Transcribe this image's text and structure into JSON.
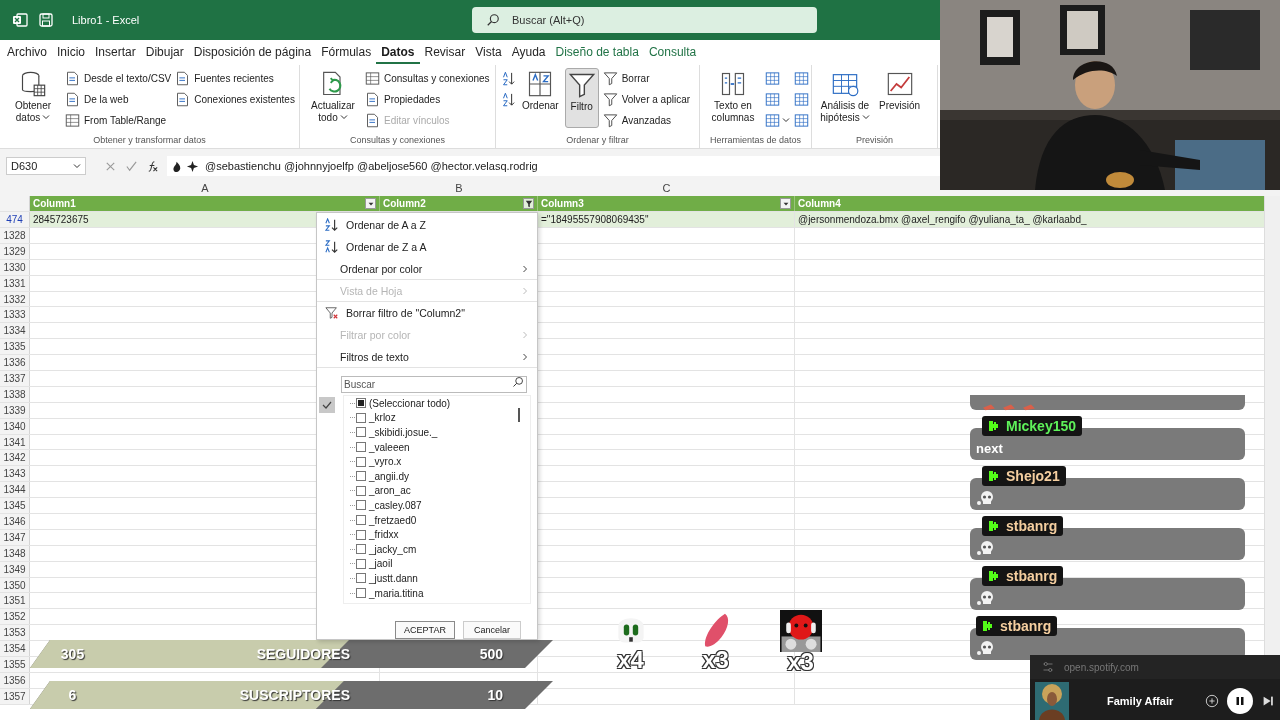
{
  "window": {
    "title": "Libro1  -  Excel"
  },
  "search": {
    "placeholder": "Buscar (Alt+Q)"
  },
  "menu_tabs": [
    {
      "label": "Archivo",
      "selected": false,
      "kind": "normal"
    },
    {
      "label": "Inicio",
      "selected": false,
      "kind": "normal"
    },
    {
      "label": "Insertar",
      "selected": false,
      "kind": "normal"
    },
    {
      "label": "Dibujar",
      "selected": false,
      "kind": "normal"
    },
    {
      "label": "Disposición de página",
      "selected": false,
      "kind": "normal"
    },
    {
      "label": "Fórmulas",
      "selected": false,
      "kind": "normal"
    },
    {
      "label": "Datos",
      "selected": true,
      "kind": "normal"
    },
    {
      "label": "Revisar",
      "selected": false,
      "kind": "normal"
    },
    {
      "label": "Vista",
      "selected": false,
      "kind": "normal"
    },
    {
      "label": "Ayuda",
      "selected": false,
      "kind": "normal"
    },
    {
      "label": "Diseño de tabla",
      "selected": false,
      "kind": "contextual"
    },
    {
      "label": "Consulta",
      "selected": false,
      "kind": "contextual"
    }
  ],
  "ribbon": {
    "groups": [
      {
        "label": "Obtener y transformar datos",
        "columns": [
          [
            {
              "kind": "large",
              "label": "Obtener datos",
              "dropdown": true
            }
          ],
          [
            {
              "kind": "small",
              "label": "Desde el texto/CSV"
            },
            {
              "kind": "small",
              "label": "De la web"
            },
            {
              "kind": "small",
              "label": "From Table/Range"
            }
          ],
          [
            {
              "kind": "small",
              "label": "Fuentes recientes"
            },
            {
              "kind": "small",
              "label": "Conexiones existentes"
            }
          ]
        ]
      },
      {
        "label": "Consultas y conexiones",
        "columns": [
          [
            {
              "kind": "large",
              "label": "Actualizar todo",
              "dropdown": true
            }
          ],
          [
            {
              "kind": "small",
              "label": "Consultas y conexiones"
            },
            {
              "kind": "small",
              "label": "Propiedades"
            },
            {
              "kind": "small",
              "label": "Editar vínculos",
              "disabled": true
            }
          ]
        ]
      },
      {
        "label": "Ordenar y filtrar",
        "columns": [
          [
            {
              "kind": "icon"
            },
            {
              "kind": "icon"
            }
          ],
          [
            {
              "kind": "large",
              "label": "Ordenar"
            }
          ],
          [
            {
              "kind": "large",
              "label": "Filtro",
              "selected": true
            }
          ],
          [
            {
              "kind": "small",
              "label": "Borrar"
            },
            {
              "kind": "small",
              "label": "Volver a aplicar"
            },
            {
              "kind": "small",
              "label": "Avanzadas"
            }
          ]
        ]
      },
      {
        "label": "Herramientas de datos",
        "columns": [
          [
            {
              "kind": "large",
              "label": "Texto en columnas"
            }
          ],
          [
            {
              "kind": "icon"
            },
            {
              "kind": "icon"
            },
            {
              "kind": "icon",
              "dropdown": true
            }
          ],
          [
            {
              "kind": "icon"
            },
            {
              "kind": "icon"
            },
            {
              "kind": "icon"
            }
          ]
        ]
      },
      {
        "label": "Previsión",
        "columns": [
          [
            {
              "kind": "large",
              "label": "Análisis de hipótesis",
              "dropdown": true
            }
          ],
          [
            {
              "kind": "large",
              "label": "Previsión"
            }
          ]
        ]
      }
    ]
  },
  "formula_bar": {
    "name_box": "D630",
    "formula": "@sebastienchu  @johnnyjoelfp  @abeljose560  @hector.velasq.rodrig"
  },
  "sheet": {
    "column_letters": [
      "A",
      "B",
      "C"
    ],
    "table_headers": [
      {
        "label": "Column1",
        "filter_active": false
      },
      {
        "label": "Column2",
        "filter_active": true
      },
      {
        "label": "Column3",
        "filter_active": false
      },
      {
        "label": "Column4"
      }
    ],
    "active_row": {
      "number": "474",
      "cells": [
        "2845723675",
        "",
        "=\"18495557908069435\"",
        "@jersonmendoza.bmx @axel_rengifo @yuliana_ta_ @karlaabd_"
      ]
    },
    "rows": [
      {
        "number": "1328"
      },
      {
        "number": "1329"
      },
      {
        "number": "1330"
      },
      {
        "number": "1331"
      },
      {
        "number": "1332"
      },
      {
        "number": "1333"
      },
      {
        "number": "1334"
      },
      {
        "number": "1335"
      },
      {
        "number": "1336"
      },
      {
        "number": "1337"
      },
      {
        "number": "1338"
      },
      {
        "number": "1339"
      },
      {
        "number": "1340"
      },
      {
        "number": "1341"
      },
      {
        "number": "1342"
      },
      {
        "number": "1343"
      },
      {
        "number": "1344"
      },
      {
        "number": "1345"
      },
      {
        "number": "1346"
      },
      {
        "number": "1347"
      },
      {
        "number": "1348"
      },
      {
        "number": "1349"
      },
      {
        "number": "1350"
      },
      {
        "number": "1351"
      },
      {
        "number": "1352"
      },
      {
        "number": "1353"
      },
      {
        "number": "1354"
      },
      {
        "number": "1355"
      },
      {
        "number": "1356"
      },
      {
        "number": "1357"
      }
    ]
  },
  "filter_menu": {
    "items": [
      {
        "label": "Ordenar de A a Z",
        "kind": "sort-az",
        "disabled": false,
        "submenu": false,
        "separator": false
      },
      {
        "label": "Ordenar de Z a A",
        "kind": "sort-za",
        "disabled": false,
        "submenu": false,
        "separator": false
      },
      {
        "label": "Ordenar por color",
        "kind": "plain",
        "disabled": false,
        "submenu": true,
        "separator": true
      },
      {
        "label": "Vista de Hoja",
        "kind": "plain",
        "disabled": true,
        "submenu": true,
        "separator": true
      },
      {
        "label": "Borrar filtro de \"Column2\"",
        "kind": "clear-filter",
        "disabled": false,
        "submenu": false,
        "separator": false
      },
      {
        "label": "Filtrar por color",
        "kind": "plain",
        "disabled": true,
        "submenu": true,
        "separator": false
      },
      {
        "label": "Filtros de texto",
        "kind": "plain",
        "disabled": false,
        "submenu": true,
        "separator": true
      }
    ],
    "search": {
      "placeholder": "Buscar"
    },
    "values": [
      {
        "label": "(Seleccionar todo)",
        "partial": true
      },
      {
        "label": "_krloz",
        "checked": false
      },
      {
        "label": "_skibidi.josue._",
        "checked": false
      },
      {
        "label": "_valeeen",
        "checked": false
      },
      {
        "label": "_vyro.x",
        "checked": false
      },
      {
        "label": "_angii.dy",
        "checked": false
      },
      {
        "label": "_aron_ac",
        "checked": false
      },
      {
        "label": "_casley.087",
        "checked": false
      },
      {
        "label": "_fretzaed0",
        "checked": false
      },
      {
        "label": "_fridxx",
        "checked": false
      },
      {
        "label": "_jacky_cm",
        "checked": false
      },
      {
        "label": "_jaoil",
        "checked": false
      },
      {
        "label": "_justt.dann",
        "checked": false
      },
      {
        "label": "_maria.titina",
        "checked": false
      }
    ],
    "buttons": [
      "ACEPTAR",
      "Cancelar"
    ]
  },
  "stream_overlay": {
    "chat": [
      {
        "kind": "emote"
      },
      {
        "user": "Mickey150",
        "color": "#5ef25a",
        "kind": "text",
        "text": "next"
      },
      {
        "user": "Shejo21",
        "color": "#f5cfa0",
        "kind": "emote"
      },
      {
        "user": "stbanrg",
        "color": "#f5cfa0",
        "kind": "emote"
      },
      {
        "user": "stbanrg",
        "color": "#f5cfa0",
        "kind": "emote"
      },
      {
        "user": "stbanrg",
        "color": "#f5cfa0",
        "kind": "emote"
      }
    ],
    "emote_counts": [
      {
        "kind": "skull",
        "count": "x4"
      },
      {
        "kind": "stroke",
        "count": "x3"
      },
      {
        "kind": "robot",
        "count": "x3"
      }
    ],
    "goals": [
      {
        "current": "305",
        "label": "SEGUIDORES",
        "goal": "500",
        "level": 0.61
      },
      {
        "current": "6",
        "label": "SUSCRIPTORES",
        "goal": "10",
        "level": 0.6
      }
    ],
    "player": {
      "site": "open.spotify.com",
      "track": "Family Affair"
    }
  }
}
